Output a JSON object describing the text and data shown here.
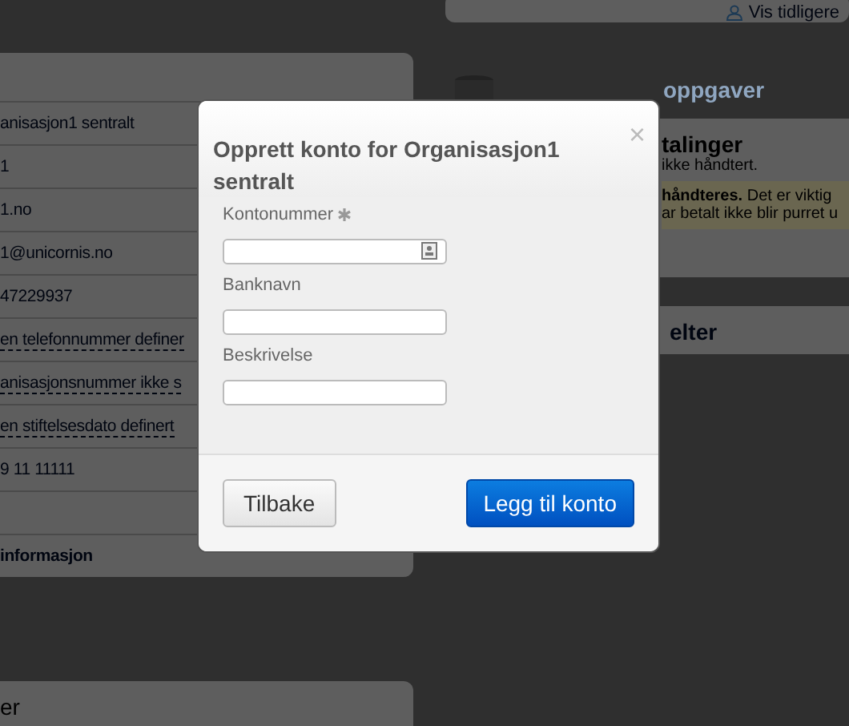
{
  "background": {
    "left_rows": [
      {
        "text": "anisasjon1 sentralt",
        "kind": "plain"
      },
      {
        "text": "1",
        "kind": "plain"
      },
      {
        "text": "1.no",
        "kind": "plain"
      },
      {
        "text": "1@unicornis.no",
        "kind": "plain"
      },
      {
        "text": "47229937",
        "kind": "plain"
      },
      {
        "text": "en telefonnummer definer",
        "kind": "link"
      },
      {
        "text": "anisasjonsnummer ikke s",
        "kind": "link"
      },
      {
        "text": "en stiftelsesdato definert",
        "kind": "link"
      },
      {
        "text": "9 11 11111",
        "kind": "plain"
      },
      {
        "text": "",
        "kind": "empty"
      },
      {
        "text": "informasjon",
        "kind": "bold"
      }
    ],
    "bottom_title": "er",
    "history_link": "Vis tidligere",
    "tasks_title": "oppgaver",
    "payments_title": "talinger",
    "payments_note": "ikke håndtert.",
    "warning_lines": [
      "**håndteres.** Det er viktig",
      "ar betalt ikke blir purret u"
    ],
    "fields_title": "elter"
  },
  "modal": {
    "title": "Opprett konto for Organisasjon1 sentralt",
    "close": "×",
    "fields": [
      {
        "label": "Kontonummer",
        "required": true,
        "kind": "lookup"
      },
      {
        "label": "Banknavn",
        "required": false,
        "kind": "text"
      },
      {
        "label": "Beskrivelse",
        "required": false,
        "kind": "text"
      }
    ],
    "buttons": [
      {
        "label": "Tilbake",
        "kind": "secondary"
      },
      {
        "label": "Legg til konto",
        "kind": "primary"
      }
    ]
  }
}
